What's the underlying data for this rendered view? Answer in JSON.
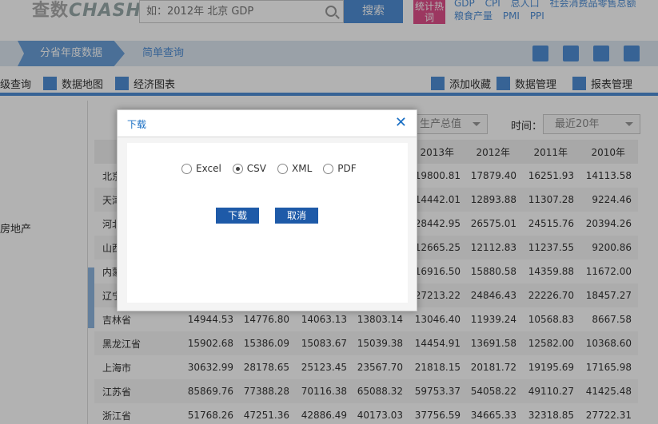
{
  "header": {
    "logo_cn": "查数",
    "logo_en": "CHASHU",
    "search_placeholder": "如：2012年 北京 GDP",
    "search_button": "搜索",
    "hot_badge": "统计热词",
    "hot_links": [
      "GDP",
      "CPI",
      "总人口",
      "社会消费品零售总额",
      "粮食产量",
      "PMI",
      "PPI"
    ]
  },
  "nav": {
    "active_tab": "分省年度数据",
    "tab2": "简单查询",
    "icons": [
      "download-icon",
      "copy-icon",
      "print-icon",
      "share-icon"
    ]
  },
  "toolbar": {
    "left_items": [
      "级查询",
      "数据地图",
      "经济图表"
    ],
    "right_items": [
      "添加收藏",
      "数据管理",
      "报表管理"
    ]
  },
  "left_panel": {
    "partial_item": "房地产"
  },
  "filters": {
    "indicator_value": "生产总值",
    "time_label": "时间：",
    "time_value": "最近20年"
  },
  "table": {
    "columns": [
      "2013年",
      "2012年",
      "2011年",
      "2010年"
    ],
    "rows": [
      {
        "region": "北京",
        "vals": [
          "",
          "",
          "",
          "",
          "19800.81",
          "17879.40",
          "16251.93",
          "14113.58"
        ]
      },
      {
        "region": "天津",
        "vals": [
          "",
          "",
          "",
          "",
          "14442.01",
          "12893.88",
          "11307.28",
          "9224.46"
        ]
      },
      {
        "region": "河北",
        "vals": [
          "",
          "",
          "",
          "",
          "28442.95",
          "26575.01",
          "24515.76",
          "20394.26"
        ]
      },
      {
        "region": "山西",
        "vals": [
          "",
          "",
          "",
          "",
          "12665.25",
          "12112.83",
          "11237.55",
          "9200.86"
        ]
      },
      {
        "region": "内蒙",
        "vals": [
          "",
          "",
          "",
          "",
          "16916.50",
          "15880.58",
          "14359.88",
          "11672.00"
        ]
      },
      {
        "region": "辽宁",
        "vals": [
          "",
          "",
          "",
          "",
          "27213.22",
          "24846.43",
          "22226.70",
          "18457.27"
        ]
      },
      {
        "region": "吉林省",
        "vals": [
          "14944.53",
          "14776.80",
          "14063.13",
          "13803.14",
          "13046.40",
          "11939.24",
          "10568.83",
          "8667.58"
        ]
      },
      {
        "region": "黑龙江省",
        "vals": [
          "15902.68",
          "15386.09",
          "15083.67",
          "15039.38",
          "14454.91",
          "13691.58",
          "12582.00",
          "10368.60"
        ]
      },
      {
        "region": "上海市",
        "vals": [
          "30632.99",
          "28178.65",
          "25123.45",
          "23567.70",
          "21818.15",
          "20181.72",
          "19195.69",
          "17165.98"
        ]
      },
      {
        "region": "江苏省",
        "vals": [
          "85869.76",
          "77388.28",
          "70116.38",
          "65088.32",
          "59753.37",
          "54058.22",
          "49110.27",
          "41425.48"
        ]
      },
      {
        "region": "浙江省",
        "vals": [
          "51768.26",
          "47251.36",
          "42886.49",
          "40173.03",
          "37756.59",
          "34665.33",
          "32318.85",
          "27722.31"
        ]
      }
    ]
  },
  "modal": {
    "title": "下载",
    "close": "✕",
    "formats": [
      "Excel",
      "CSV",
      "XML",
      "PDF"
    ],
    "selected_format": "CSV",
    "download_button": "下载",
    "cancel_button": "取消"
  }
}
